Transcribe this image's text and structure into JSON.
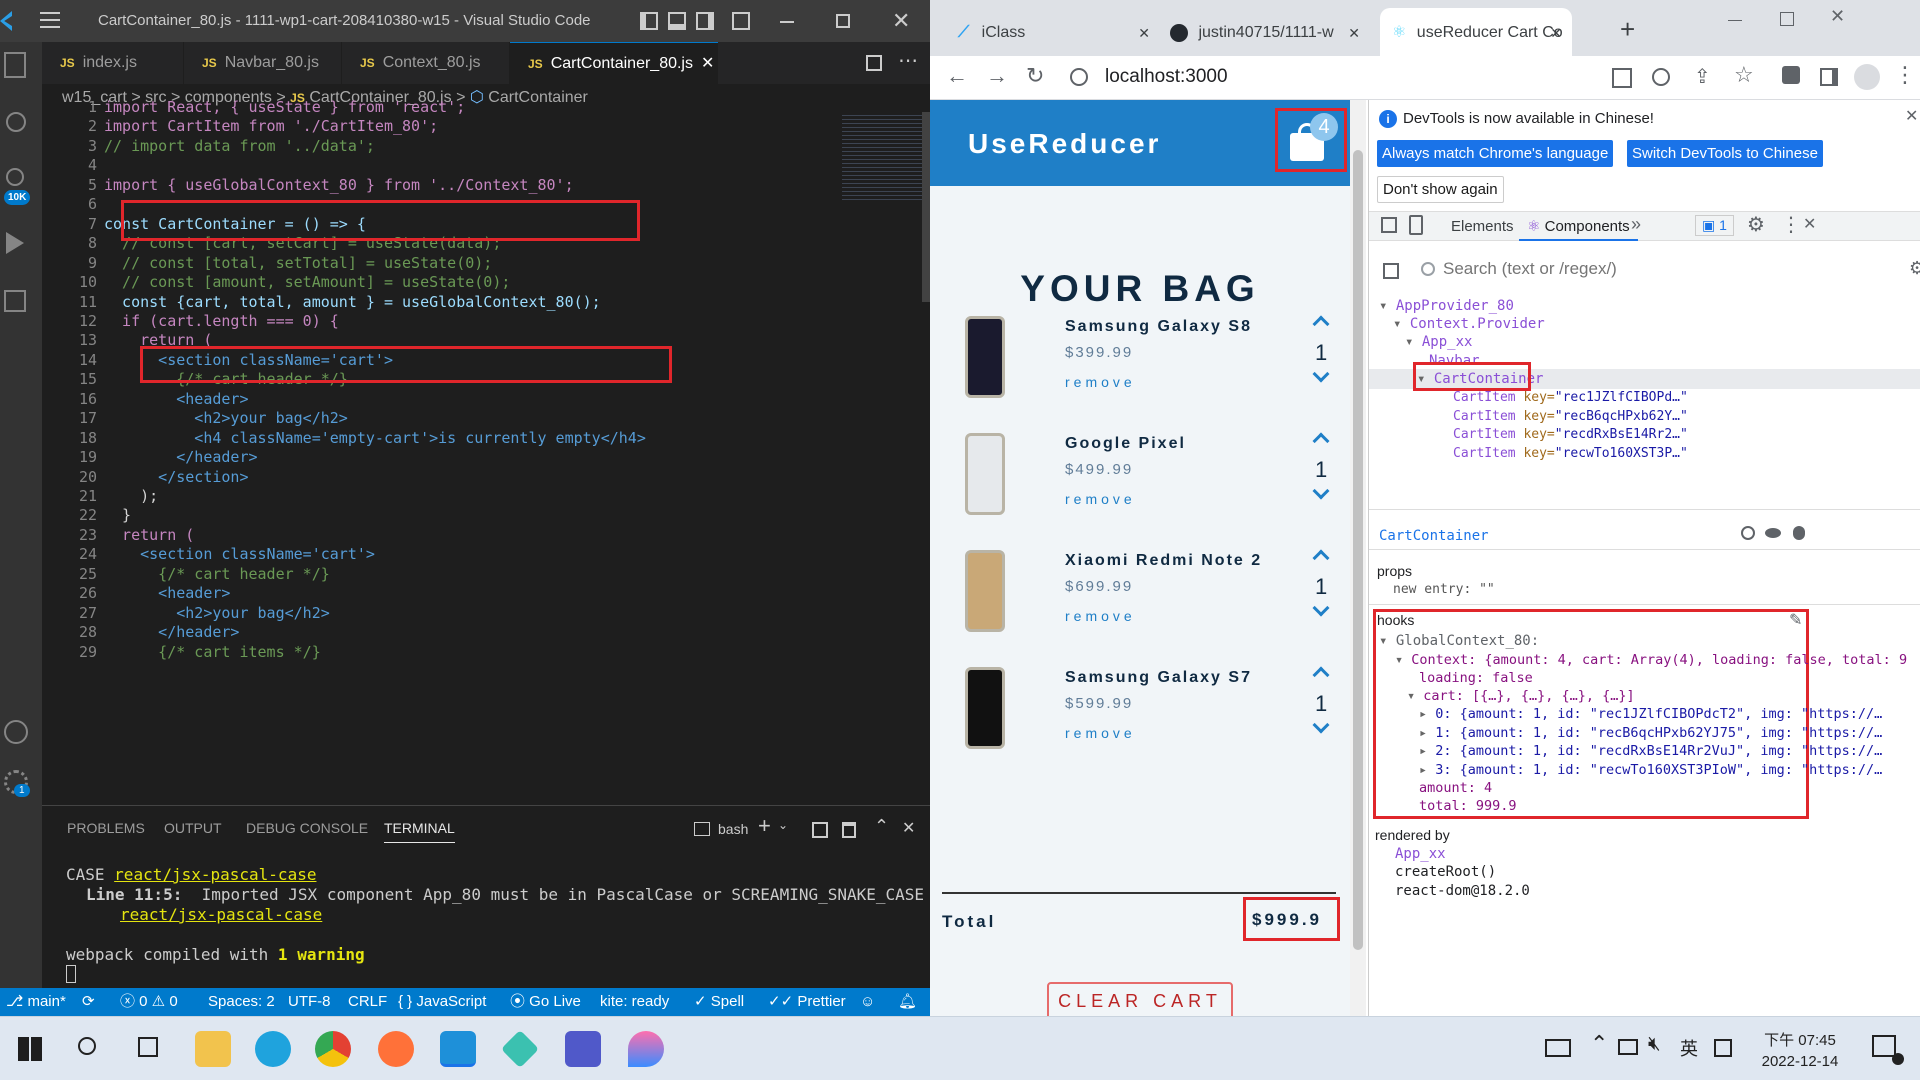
{
  "vscode": {
    "title": "CartContainer_80.js - 1111-wp1-cart-208410380-w15 - Visual Studio Code",
    "tabs": [
      {
        "label": "index.js"
      },
      {
        "label": "Navbar_80.js"
      },
      {
        "label": "Context_80.js"
      },
      {
        "label": "CartContainer_80.js"
      }
    ],
    "js_badge": "JS",
    "breadcrumb": [
      "w15_cart",
      ">",
      "src",
      ">",
      "components",
      ">",
      "CartContainer_80.js",
      ">",
      "CartContainer"
    ],
    "badge_10k": "10K",
    "badge_1": "1",
    "code_lines": [
      {
        "n": "1",
        "t": "import React, { useState } from 'react';"
      },
      {
        "n": "2",
        "t": "import CartItem from './CartItem_80';"
      },
      {
        "n": "3",
        "t": "// import data from '../data';"
      },
      {
        "n": "4",
        "t": ""
      },
      {
        "n": "5",
        "t": "import { useGlobalContext_80 } from '../Context_80';"
      },
      {
        "n": "6",
        "t": ""
      },
      {
        "n": "7",
        "t": "const CartContainer = () => {"
      },
      {
        "n": "8",
        "t": "  // const [cart, setCart] = useState(data);"
      },
      {
        "n": "9",
        "t": "  // const [total, setTotal] = useState(0);"
      },
      {
        "n": "10",
        "t": "  // const [amount, setAmount] = useState(0);"
      },
      {
        "n": "11",
        "t": "  const {cart, total, amount } = useGlobalContext_80();"
      },
      {
        "n": "12",
        "t": "  if (cart.length === 0) {"
      },
      {
        "n": "13",
        "t": "    return ("
      },
      {
        "n": "14",
        "t": "      <section className='cart'>"
      },
      {
        "n": "15",
        "t": "        {/* cart header */}"
      },
      {
        "n": "16",
        "t": "        <header>"
      },
      {
        "n": "17",
        "t": "          <h2>your bag</h2>"
      },
      {
        "n": "18",
        "t": "          <h4 className='empty-cart'>is currently empty</h4>"
      },
      {
        "n": "19",
        "t": "        </header>"
      },
      {
        "n": "20",
        "t": "      </section>"
      },
      {
        "n": "21",
        "t": "    );"
      },
      {
        "n": "22",
        "t": "  }"
      },
      {
        "n": "23",
        "t": "  return ("
      },
      {
        "n": "24",
        "t": "    <section className='cart'>"
      },
      {
        "n": "25",
        "t": "      {/* cart header */}"
      },
      {
        "n": "26",
        "t": "      <header>"
      },
      {
        "n": "27",
        "t": "        <h2>your bag</h2>"
      },
      {
        "n": "28",
        "t": "      </header>"
      },
      {
        "n": "29",
        "t": "      {/* cart items */}"
      }
    ],
    "panel_tabs": [
      "PROBLEMS",
      "OUTPUT",
      "DEBUG CONSOLE",
      "TERMINAL"
    ],
    "shell": "bash",
    "terminal": {
      "l1_a": "CASE",
      "l1_b": "react/jsx-pascal-case",
      "l2_a": "Line 11:5:",
      "l2_b": "  Imported JSX component App_80 must be in PascalCase or SCREAMING_SNAKE_CASE",
      "l3": "react/jsx-pascal-case",
      "l4_a": "webpack compiled with ",
      "l4_b": "1 warning"
    },
    "status": {
      "branch": "main*",
      "errors": "0",
      "warnings": "0",
      "spaces": "Spaces: 2",
      "encoding": "UTF-8",
      "eol": "CRLF",
      "lang": "JavaScript",
      "golive": "Go Live",
      "kite": "kite: ready",
      "spell": "Spell",
      "prettier": "Prettier"
    }
  },
  "chrome": {
    "tabs": [
      {
        "label": "iClass"
      },
      {
        "label": "justin40715/1111-w"
      },
      {
        "label": "useReducer Cart Co"
      }
    ],
    "url": "localhost:3000"
  },
  "app": {
    "brand": "UseReducer",
    "cart_count": "4",
    "heading": "YOUR BAG",
    "items": [
      {
        "name": "Samsung Galaxy S8",
        "price": "$399.99",
        "amount": "1",
        "remove": "remove"
      },
      {
        "name": "Google Pixel",
        "price": "$499.99",
        "amount": "1",
        "remove": "remove"
      },
      {
        "name": "Xiaomi Redmi Note 2",
        "price": "$699.99",
        "amount": "1",
        "remove": "remove"
      },
      {
        "name": "Samsung Galaxy S7",
        "price": "$599.99",
        "amount": "1",
        "remove": "remove"
      }
    ],
    "total_label": "Total",
    "total_value": "$999.9",
    "clear": "CLEAR CART"
  },
  "devtools": {
    "notice": "DevTools is now available in Chinese!",
    "btn1": "Always match Chrome's language",
    "btn2": "Switch DevTools to Chinese",
    "btn3": "Don't show again",
    "tab_elements": "Elements",
    "tab_components": "Components",
    "issues": "1",
    "search_placeholder": "Search (text or /regex/)",
    "tree": {
      "root": "AppProvider_80",
      "ctx": "Context.Provider",
      "app": "App_xx",
      "navbar": "Navbar",
      "cc": "CartContainer",
      "items": [
        {
          "key": "rec1JZlfCIBOPd…"
        },
        {
          "key": "recB6qcHPxb62Y…"
        },
        {
          "key": "recdRxBsE14Rr2…"
        },
        {
          "key": "recwTo160XST3P…"
        }
      ],
      "item_name": "CartItem",
      "key_attr": "key="
    },
    "selected": "CartContainer",
    "props_title": "props",
    "new_entry": "new entry: \"\"",
    "hooks_title": "hooks",
    "hook_name": "GlobalContext_80:",
    "ctx_line": "Context: {amount: 4, cart: Array(4), loading: false, total: 9",
    "loading": "loading: false",
    "cart_line": "cart: [{…}, {…}, {…}, {…}]",
    "cart_items": [
      "0: {amount: 1, id: \"rec1JZlfCIBOPdcT2\", img: \"https://…",
      "1: {amount: 1, id: \"recB6qcHPxb62YJ75\", img: \"https://…",
      "2: {amount: 1, id: \"recdRxBsE14Rr2VuJ\", img: \"https://…",
      "3: {amount: 1, id: \"recwTo160XST3PIoW\", img: \"https://…"
    ],
    "amount": "amount: 4",
    "total": "total: 999.9",
    "rendered_by": "rendered by",
    "r1": "App_xx",
    "r2": "createRoot()",
    "r3": "react-dom@18.2.0"
  },
  "taskbar": {
    "time": "下午 07:45",
    "date": "2022-12-14",
    "ime": "英"
  }
}
